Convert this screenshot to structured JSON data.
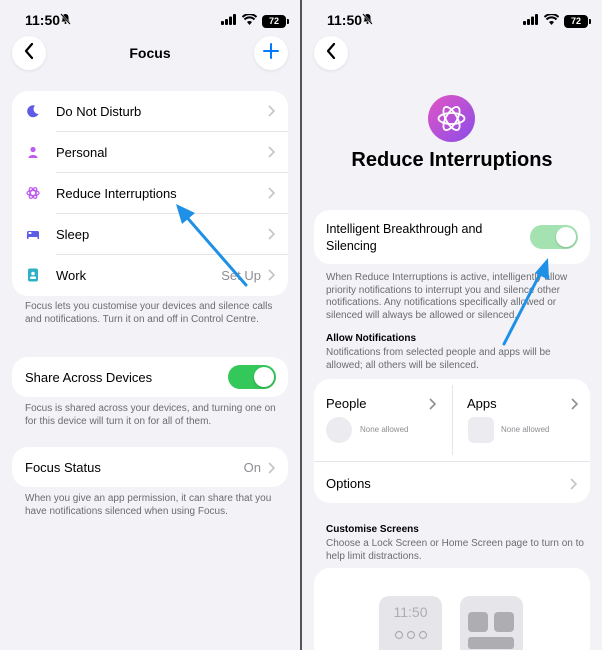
{
  "status": {
    "time": "11:50",
    "battery": "72"
  },
  "left": {
    "title": "Focus",
    "focus_items": [
      {
        "label": "Do Not Disturb",
        "value": "",
        "icon": "moon-icon",
        "color": "#5e5ce6"
      },
      {
        "label": "Personal",
        "value": "",
        "icon": "person-icon",
        "color": "#bf5af2"
      },
      {
        "label": "Reduce Interruptions",
        "value": "",
        "icon": "reduce-interruptions-icon",
        "color": "#bf5af2"
      },
      {
        "label": "Sleep",
        "value": "",
        "icon": "bed-icon",
        "color": "#5e5ce6"
      },
      {
        "label": "Work",
        "value": "Set Up",
        "icon": "badge-icon",
        "color": "#30b0c7"
      }
    ],
    "focus_note": "Focus lets you customise your devices and silence calls and notifications. Turn it on and off in Control Centre.",
    "share_label": "Share Across Devices",
    "share_note": "Focus is shared across your devices, and turning one on for this device will turn it on for all of them.",
    "status_label": "Focus Status",
    "status_value": "On",
    "status_note": "When you give an app permission, it can share that you have notifications silenced when using Focus."
  },
  "right": {
    "title": "Reduce Interruptions",
    "toggle_label": "Intelligent Breakthrough and Silencing",
    "toggle_note": "When Reduce Interruptions is active, intelligently allow priority notifications to interrupt you and silence other notifications. Any notifications specifically allowed or silenced will always be allowed or silenced.",
    "allow_title": "Allow Notifications",
    "allow_note": "Notifications from selected people and apps will be allowed; all others will be silenced.",
    "people_label": "People",
    "people_value": "None allowed",
    "apps_label": "Apps",
    "apps_value": "None allowed",
    "options_label": "Options",
    "customise_title": "Customise Screens",
    "customise_note": "Choose a Lock Screen or Home Screen page to turn on to help limit distractions.",
    "lock_preview_time": "11:50"
  },
  "colors": {
    "accent": "#007aff",
    "toggle_on": "#34c759",
    "arrow": "#1e90e6"
  }
}
